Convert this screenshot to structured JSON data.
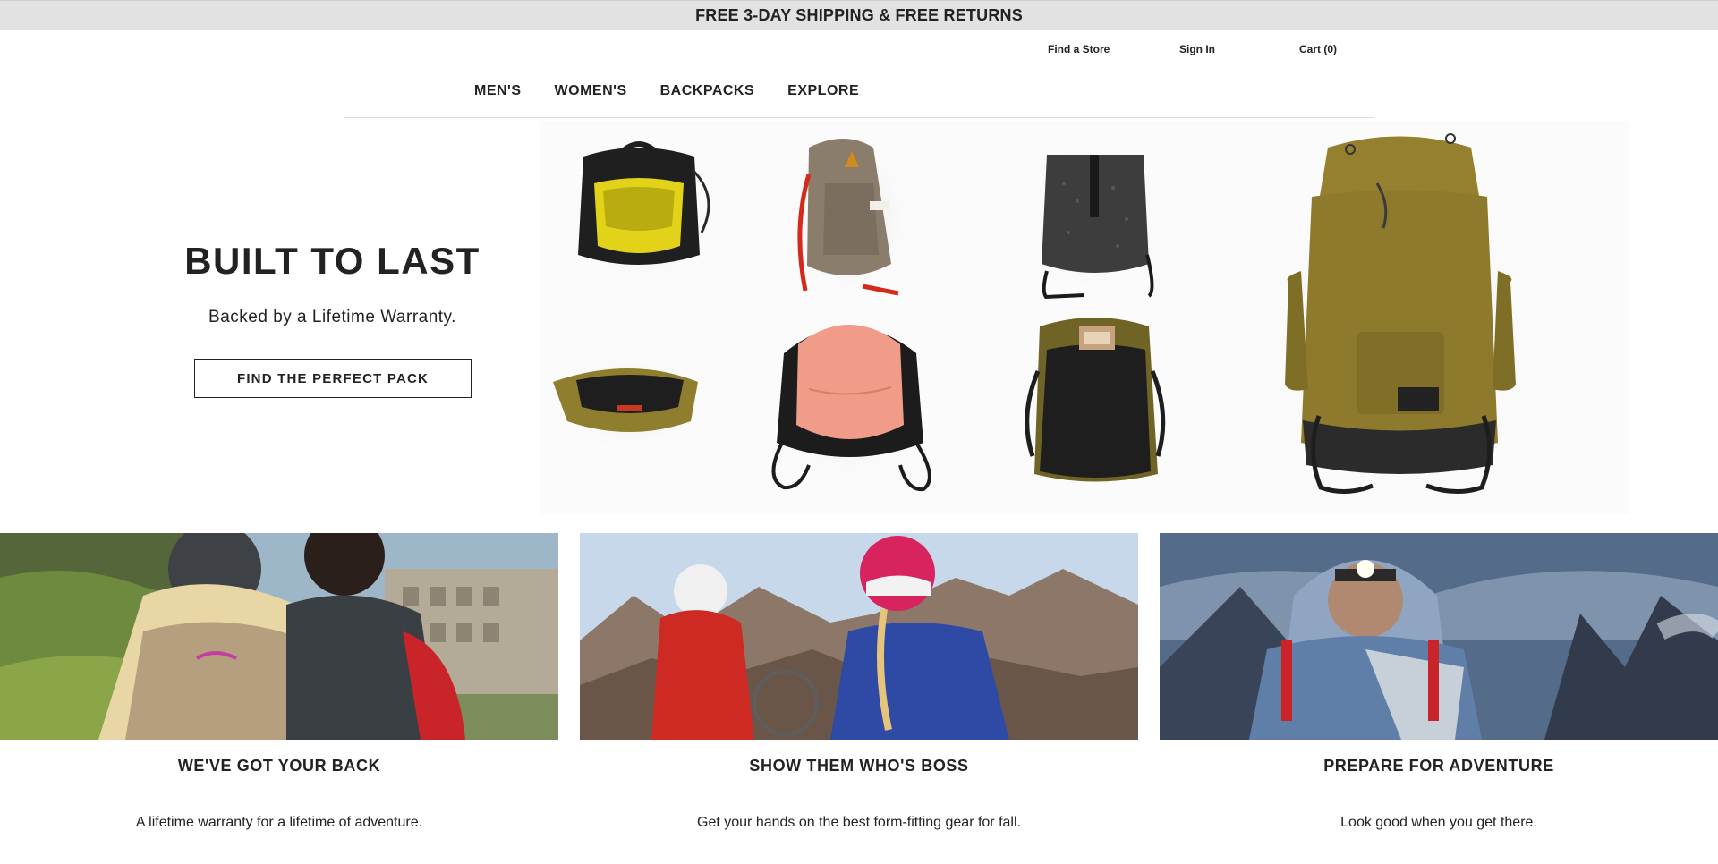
{
  "promo_bar": {
    "text": "FREE 3-DAY SHIPPING & FREE RETURNS"
  },
  "utility_nav": {
    "find_store": "Find a Store",
    "sign_in": "Sign In",
    "cart": "Cart (0)"
  },
  "main_nav": [
    "MEN'S",
    "WOMEN'S",
    "BACKPACKS",
    "EXPLORE"
  ],
  "hero": {
    "title": "BUILT TO LAST",
    "subtitle": "Backed by a Lifetime Warranty.",
    "cta": "FIND THE PERFECT PACK"
  },
  "tiles": [
    {
      "title": "WE'VE GOT YOUR BACK",
      "text": "A lifetime warranty for a lifetime of adventure."
    },
    {
      "title": "SHOW THEM WHO'S BOSS",
      "text": "Get your hands on the best form-fitting gear for fall."
    },
    {
      "title": "PREPARE FOR ADVENTURE",
      "text": "Look good when you get there."
    }
  ],
  "colors": {
    "promo_bg": "#e2e2e2",
    "text": "#222222",
    "olive_pack": "#8d7a2c"
  }
}
